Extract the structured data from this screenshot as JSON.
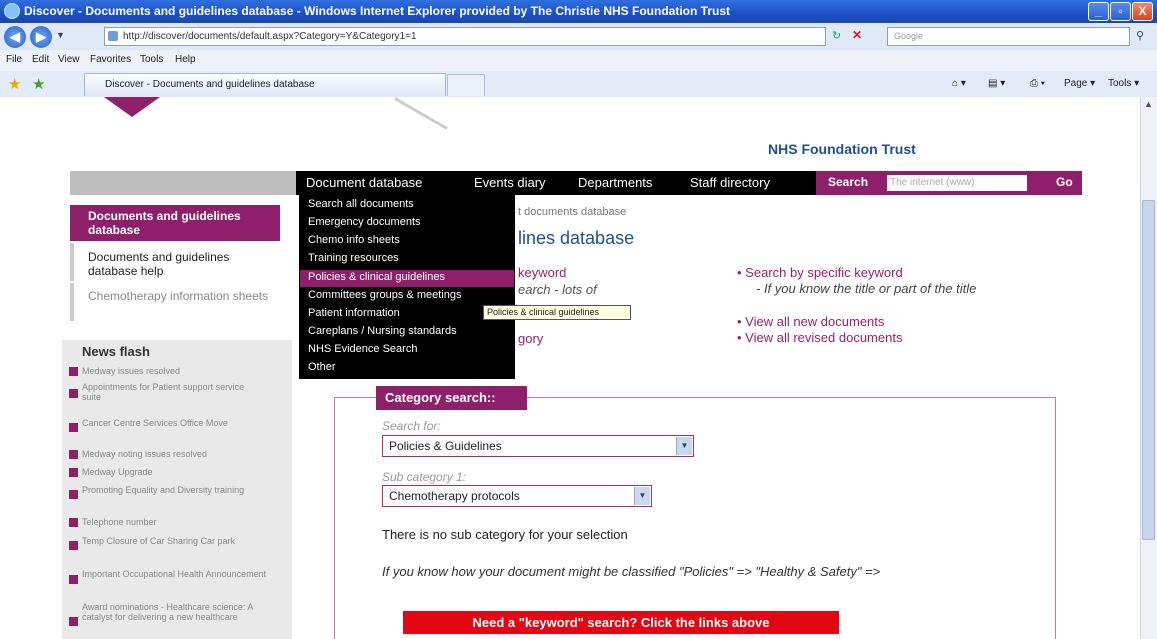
{
  "window": {
    "title": "Discover - Documents and guidelines database - Windows Internet Explorer provided by The Christie NHS Foundation Trust",
    "min_label": "_",
    "max_label": "▫",
    "close_label": "X"
  },
  "address": {
    "url": "http://discover/documents/default.aspx?Category=Y&Category1=1",
    "search_placeholder": "Google"
  },
  "menu": [
    "File",
    "Edit",
    "View",
    "Favorites",
    "Tools",
    "Help"
  ],
  "tab": {
    "label": "Discover - Documents and guidelines database",
    "page_label": "Page ▾",
    "tools_label": "Tools ▾"
  },
  "site": {
    "trust_name": "NHS Foundation Trust",
    "nav": [
      "Document database",
      "Events diary",
      "Departments",
      "Staff directory"
    ],
    "search_label": "Search",
    "search_placeholder": "The internet (www)",
    "go_label": "Go"
  },
  "dropdown": {
    "items": [
      "Search all documents",
      "Emergency documents",
      "Chemo info sheets",
      "Training resources",
      "Policies & clinical guidelines",
      "Committees groups & meetings",
      "Patient information",
      "Careplans / Nursing standards",
      "NHS Evidence Search",
      "Other"
    ],
    "tooltip": "Policies & clinical guidelines"
  },
  "sidebar": {
    "active": "Documents and guidelines database",
    "links": [
      "Documents and guidelines database help",
      "Chemotherapy information sheets"
    ],
    "news_title": "News flash",
    "news": [
      "Medway issues resolved",
      "Appointments for Patient support service suite",
      "Cancer Centre Services Office Move",
      "Medway noting issues resolved",
      "Medway Upgrade",
      "Promoting Equality and Diversity training",
      "Telephone number",
      "Temp Closure of Car Sharing Car park",
      "Important Occupational Health Announcement",
      "Award nominations - Healthcare science: A catalyst for delivering a new healthcare"
    ]
  },
  "main": {
    "breadcrumb_fragment": "t documents database",
    "heading_fragment": "lines database",
    "left_fragments": [
      "keyword",
      "earch - lots of",
      "gory"
    ],
    "right_links": {
      "specific": "Search by specific keyword",
      "specific_note": "- If you know the title or part of the title",
      "new_docs": "View all new documents",
      "revised_docs": "View all revised documents"
    }
  },
  "category": {
    "title": "Category search::",
    "search_for_label": "Search for:",
    "search_for_value": "Policies & Guidelines",
    "sub_label": "Sub category 1:",
    "sub_value": "Chemotherapy protocols",
    "no_sub": "There is no sub category for your selection",
    "hint": "If you know how your document might be classified \"Policies\" => \"Healthy & Safety\" =>",
    "keyword_button": "Need a \"keyword\" search? Click the links above"
  },
  "colors": {
    "brand": "#8e1f6a",
    "nav_bg": "#000000",
    "keyword_button": "#e30613",
    "trust_text": "#1f4e9a"
  }
}
